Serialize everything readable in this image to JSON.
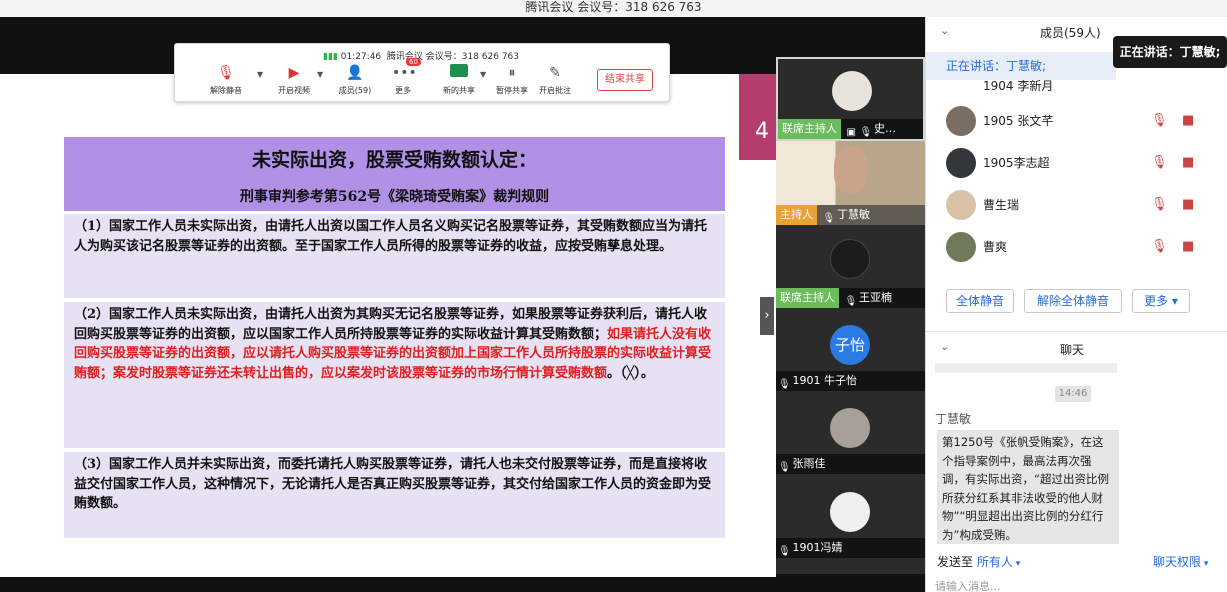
{
  "window": {
    "title": "腾讯会议 会议号：318 626 763"
  },
  "toolbar": {
    "timer": "01:27:46",
    "meeting_label": "腾讯会议 会议号：318 626 763",
    "buttons": [
      {
        "label": "解除静音",
        "icon": "mic-muted-icon"
      },
      {
        "label": "开启视频",
        "icon": "camera-off-icon"
      },
      {
        "label": "成员(59)",
        "icon": "members-icon"
      },
      {
        "label": "更多",
        "icon": "more-icon",
        "badge": "60"
      },
      {
        "label": "新的共享",
        "icon": "share-screen-icon"
      },
      {
        "label": "暂停共享",
        "icon": "pause-share-icon"
      },
      {
        "label": "开启批注",
        "icon": "annotate-icon"
      }
    ],
    "end_share": "结束共享"
  },
  "slide": {
    "title": "未实际出资，股票受贿数额认定：",
    "subtitle": "刑事审判参考第562号《梁晓琦受贿案》裁判规则",
    "page_number": "4",
    "para1": "（1）国家工作人员未实际出资，由请托人出资以国工作人员名义购买记名股票等证券，其受贿数额应当为请托人为购买该记名股票等证券的出资额。至于国家工作人员所得的股票等证券的收益，应按受贿孳息处理。",
    "para2_a": "（2）国家工作人员未实际出资，由请托人出资为其购买无记名股票等证券，如果股票等证券获利后，请托人收回购买股票等证券的出资额，应以国家工作人员所持股票等证券的实际收益计算其受贿数额；",
    "para2_red": "如果请托人没有收回购买股票等证券的出资额，应以请托人购买股票等证券的出资额加上国家工作人员所持股票的实际收益计算受贿额；案发时股票等证券还未转让出售的，应以案发时该股票等证券的市场行情计算受贿数额",
    "para2_b": "。（╳）。",
    "para3": "（3）国家工作人员并未实际出资，而委托请托人购买股票等证券，请托人也未交付股票等证券，而是直接将收益交付国家工作人员，这种情况下，无论请托人是否真正购买股票等证券，其交付给国家工作人员的资金即为受贿数额。"
  },
  "video_tiles": [
    {
      "role": "联席主持人",
      "name": "史…"
    },
    {
      "role": "主持人",
      "name": "丁慧敏"
    },
    {
      "role": "联席主持人",
      "name": "王亚楠"
    },
    {
      "role": "",
      "name": "1901 牛子怡",
      "avatar_text": "子怡"
    },
    {
      "role": "",
      "name": "张雨佳"
    },
    {
      "role": "",
      "name": "1901冯婧"
    }
  ],
  "panel": {
    "members_title": "成员(59人)",
    "speaking": "正在讲话：丁慧敏;",
    "tooltip": "正在讲话：丁慧敏;",
    "partial_member": "1904 李新月",
    "members": [
      {
        "name": "1905 张文芊"
      },
      {
        "name": "1905李志超"
      },
      {
        "name": "曹生瑞"
      },
      {
        "name": "曹爽"
      }
    ],
    "mute_all": "全体静音",
    "unmute_all": "解除全体静音",
    "more": "更多",
    "chat_title": "聊天",
    "chat_time": "14:46",
    "chat_sender": "丁慧敏",
    "chat_message": "第1250号《张帆受贿案》，在这个指导案例中，最高法再次强调，有实际出资，“超过出资比例所获分红系其非法收受的他人财物”“明显超出出资比例的分红行为”构成受贿。",
    "send_to_label": "发送至",
    "send_to_value": "所有人",
    "chat_permission": "聊天权限",
    "input_placeholder": "请输入消息..."
  },
  "colors": {
    "accent": "#2a6cd8",
    "host_badge": "#e8a23a",
    "cohost_badge": "#6bbd5b",
    "title_box": "#b091e6",
    "para_box": "#e7e1f4"
  }
}
